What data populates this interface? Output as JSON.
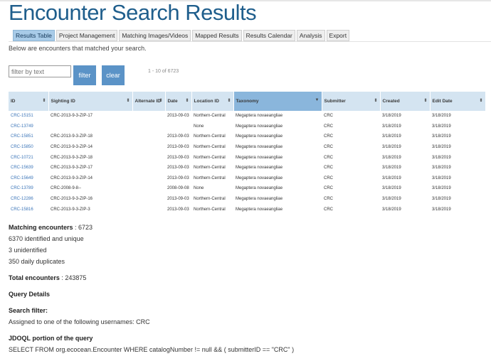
{
  "page": {
    "title": "Encounter Search Results",
    "subtitle": "Below are encounters that matched your search."
  },
  "tabs": [
    {
      "label": "Results Table",
      "active": true
    },
    {
      "label": "Project Management",
      "active": false
    },
    {
      "label": "Matching Images/Videos",
      "active": false
    },
    {
      "label": "Mapped Results",
      "active": false
    },
    {
      "label": "Results Calendar",
      "active": false
    },
    {
      "label": "Analysis",
      "active": false
    },
    {
      "label": "Export",
      "active": false
    }
  ],
  "filter": {
    "placeholder": "filter by text",
    "filter_label": "filter",
    "clear_label": "clear",
    "paging": "1 - 10 of 6723"
  },
  "table": {
    "columns": [
      "ID",
      "Sighting ID",
      "Alternate ID",
      "Date",
      "Location ID",
      "Taxonomy",
      "Submitter",
      "Created",
      "Edit Date"
    ],
    "sorted_column": "Taxonomy",
    "rows": [
      [
        "CRC-15151",
        "CRC-2013-9-3-ZIP-17",
        "",
        "2013-09-03",
        "Northern-Central",
        "Megaptera novaeangliae",
        "CRC",
        "3/18/2019",
        "3/18/2019"
      ],
      [
        "CRC-13749",
        "",
        "",
        "",
        "None",
        "Megaptera novaeangliae",
        "CRC",
        "3/18/2019",
        "3/18/2019"
      ],
      [
        "CRC-15851",
        "CRC-2013-9-3-ZIP-18",
        "",
        "2013-09-03",
        "Northern-Central",
        "Megaptera novaeangliae",
        "CRC",
        "3/18/2019",
        "3/18/2019"
      ],
      [
        "CRC-15850",
        "CRC-2013-9-3-ZIP-14",
        "",
        "2013-09-03",
        "Northern-Central",
        "Megaptera novaeangliae",
        "CRC",
        "3/18/2019",
        "3/18/2019"
      ],
      [
        "CRC-10721",
        "CRC-2013-9-3-ZIP-18",
        "",
        "2013-09-03",
        "Northern-Central",
        "Megaptera novaeangliae",
        "CRC",
        "3/18/2019",
        "3/18/2019"
      ],
      [
        "CRC-15639",
        "CRC-2013-9-3-ZIP-17",
        "",
        "2013-09-03",
        "Northern-Central",
        "Megaptera novaeangliae",
        "CRC",
        "3/18/2019",
        "3/18/2019"
      ],
      [
        "CRC-15649",
        "CRC-2013-9-3-ZIP-14",
        "",
        "2013-09-03",
        "Northern-Central",
        "Megaptera novaeangliae",
        "CRC",
        "3/18/2019",
        "3/18/2019"
      ],
      [
        "CRC-13789",
        "CRC-2008-9-8--",
        "",
        "2008-09-08",
        "None",
        "Megaptera novaeangliae",
        "CRC",
        "3/18/2019",
        "3/18/2019"
      ],
      [
        "CRC-12286",
        "CRC-2013-9-3-ZIP-16",
        "",
        "2013-09-03",
        "Northern-Central",
        "Megaptera novaeangliae",
        "CRC",
        "3/18/2019",
        "3/18/2019"
      ],
      [
        "CRC-15816",
        "CRC-2013-9-3-ZIP-3",
        "",
        "2013-09-03",
        "Northern-Central",
        "Megaptera novaeangliae",
        "CRC",
        "3/18/2019",
        "3/18/2019"
      ]
    ]
  },
  "stats": {
    "matching_label": "Matching encounters",
    "matching_value": ": 6723",
    "identified": "6370 identified and unique",
    "unidentified": "3 unidentified",
    "daily_dupes": "350 daily duplicates",
    "total_label": "Total encounters",
    "total_value": ": 243875",
    "query_details": "Query Details",
    "search_filter_label": "Search filter:",
    "search_filter_text": "Assigned to one of the following usernames: CRC",
    "jdoql_label": "JDOQL portion of the query",
    "jdoql_text": "SELECT FROM org.ecocean.Encounter WHERE catalogNumber != null && ( submitterID == \"CRC\" )"
  }
}
